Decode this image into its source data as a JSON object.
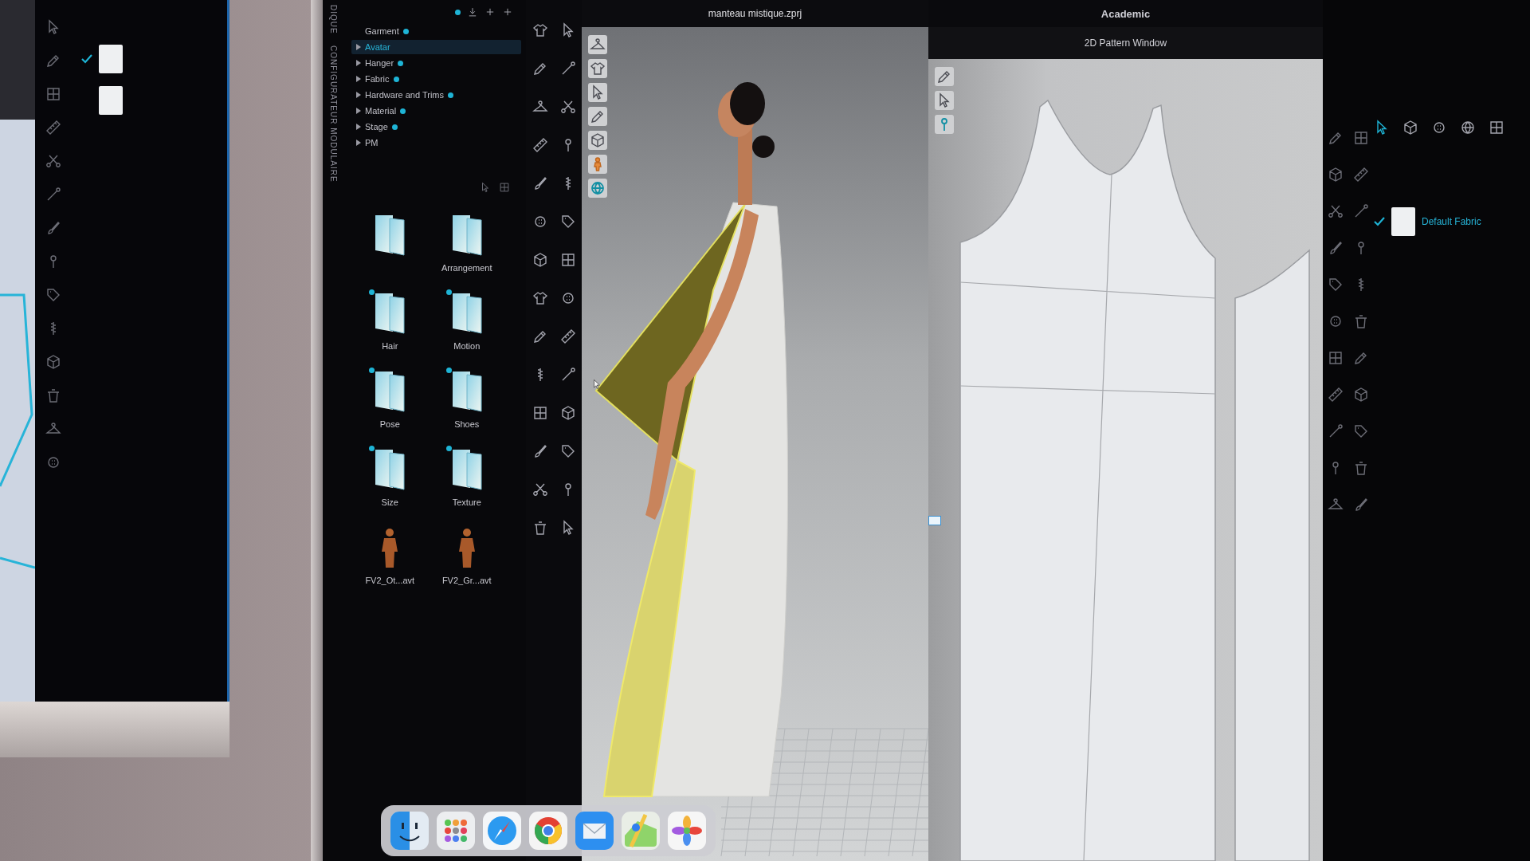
{
  "left_monitor": {
    "swatches": [
      {
        "checked": true
      },
      {
        "checked": false
      }
    ]
  },
  "sidebar": {
    "vertical_labels": [
      "DIQUE",
      "CONFIGURATEUR MODULAIRE"
    ],
    "tree": [
      {
        "label": "Garment",
        "expandable": false,
        "dot": true,
        "selected": false
      },
      {
        "label": "Avatar",
        "expandable": true,
        "dot": false,
        "selected": true
      },
      {
        "label": "Hanger",
        "expandable": true,
        "dot": true,
        "selected": false
      },
      {
        "label": "Fabric",
        "expandable": true,
        "dot": true,
        "selected": false
      },
      {
        "label": "Hardware and Trims",
        "expandable": true,
        "dot": true,
        "selected": false
      },
      {
        "label": "Material",
        "expandable": true,
        "dot": true,
        "selected": false
      },
      {
        "label": "Stage",
        "expandable": true,
        "dot": true,
        "selected": false
      },
      {
        "label": "PM",
        "expandable": true,
        "dot": false,
        "selected": false
      }
    ],
    "library": [
      {
        "kind": "folder",
        "badge": false
      },
      {
        "kind": "folder",
        "label": "Arrangement",
        "badge": false
      },
      {
        "kind": "folder",
        "label": "Hair",
        "badge": true
      },
      {
        "kind": "folder",
        "label": "Motion",
        "badge": true
      },
      {
        "kind": "folder",
        "label": "Pose",
        "badge": true
      },
      {
        "kind": "folder",
        "label": "Shoes",
        "badge": true
      },
      {
        "kind": "folder",
        "label": "Size",
        "badge": true
      },
      {
        "kind": "folder",
        "label": "Texture",
        "badge": true
      },
      {
        "kind": "avatar",
        "label": "FV2_Ot...avt",
        "badge": false
      },
      {
        "kind": "avatar",
        "label": "FV2_Gr...avt",
        "badge": false
      }
    ]
  },
  "viewport": {
    "title": "manteau mistique.zprj"
  },
  "app_title": "Academic",
  "pattern_window": {
    "title": "2D Pattern Window"
  },
  "properties_panel": {
    "fabrics": [
      {
        "label": "Default Fabric",
        "checked": true
      }
    ]
  }
}
